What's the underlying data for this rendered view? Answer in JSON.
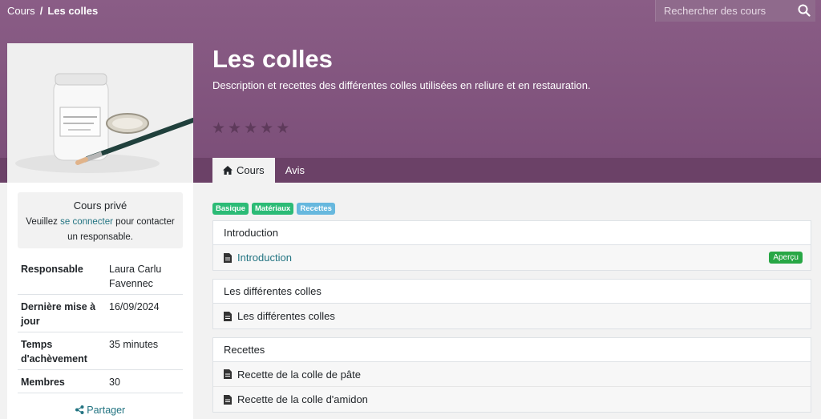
{
  "breadcrumb": {
    "root": "Cours",
    "separator": "/",
    "current": "Les colles"
  },
  "search": {
    "placeholder": "Rechercher des cours"
  },
  "course": {
    "title": "Les colles",
    "description": "Description et recettes des différentes colles utilisées en reliure et en restauration.",
    "rating": 0,
    "stars": 5
  },
  "tabs": [
    {
      "label": "Cours",
      "icon": "home-icon",
      "active": true
    },
    {
      "label": "Avis",
      "active": false
    }
  ],
  "sidebar": {
    "private_title": "Cours privé",
    "private_text_before": "Veuillez ",
    "private_link": "se connecter",
    "private_text_after": " pour contacter un responsable.",
    "info": [
      {
        "key": "Responsable",
        "value": "Laura Carlu Favennec"
      },
      {
        "key": "Dernière mise à jour",
        "value": "16/09/2024"
      },
      {
        "key": "Temps d'achèvement",
        "value": "35 minutes"
      },
      {
        "key": "Membres",
        "value": "30"
      }
    ],
    "share": "Partager"
  },
  "tags": [
    {
      "label": "Basique",
      "color": "#2cbb76"
    },
    {
      "label": "Matériaux",
      "color": "#2cbb76"
    },
    {
      "label": "Recettes",
      "color": "#67b8de"
    }
  ],
  "sections": [
    {
      "title": "Introduction",
      "items": [
        {
          "label": "Introduction",
          "link": true,
          "badge": "Aperçu"
        }
      ]
    },
    {
      "title": "Les différentes colles",
      "items": [
        {
          "label": "Les différentes colles"
        }
      ]
    },
    {
      "title": "Recettes",
      "items": [
        {
          "label": "Recette de la colle de pâte"
        },
        {
          "label": "Recette de la colle d'amidon"
        }
      ]
    }
  ],
  "colors": {
    "hero": "#8a5d86",
    "accent": "#237482",
    "badge": "#28a745"
  }
}
